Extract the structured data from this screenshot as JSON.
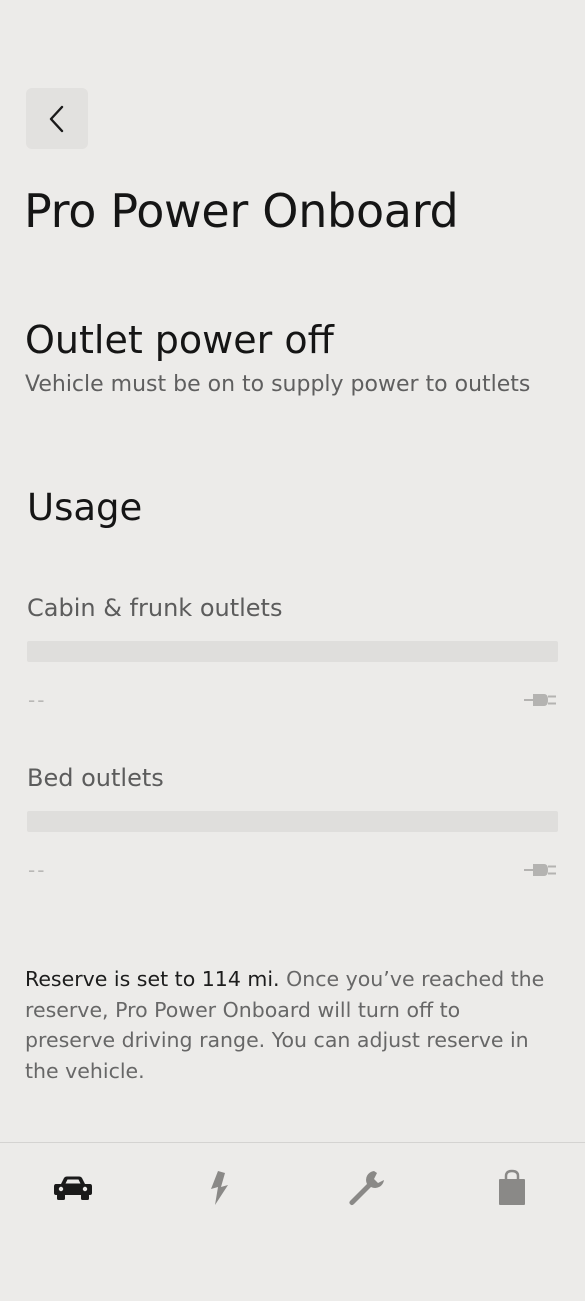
{
  "header": {
    "title": "Pro Power Onboard"
  },
  "status": {
    "title": "Outlet power off",
    "description": "Vehicle must be on to supply power to outlets"
  },
  "usage": {
    "heading": "Usage",
    "outlets": [
      {
        "label": "Cabin & frunk outlets",
        "value": "--",
        "level": 0,
        "icon": "plug-icon"
      },
      {
        "label": "Bed outlets",
        "value": "--",
        "level": 0,
        "icon": "plug-icon"
      }
    ]
  },
  "reserve": {
    "lead": "Reserve is set to 114 mi.",
    "body": " Once you’ve reached the reserve, Pro Power Onboard will turn off to preserve driving range. You can adjust reserve in the vehicle."
  },
  "nav": {
    "items": [
      {
        "icon": "vehicle-icon",
        "active": true
      },
      {
        "icon": "charging-icon",
        "active": false
      },
      {
        "icon": "service-wrench-icon",
        "active": false
      },
      {
        "icon": "shop-bag-icon",
        "active": false
      }
    ]
  },
  "colors": {
    "background": "#ecebe9",
    "text_primary": "#151515",
    "text_secondary": "#5f5f5f",
    "bar_track": "#dfdedc",
    "icon_inactive": "#8a8987",
    "icon_active": "#1a1a1a"
  }
}
